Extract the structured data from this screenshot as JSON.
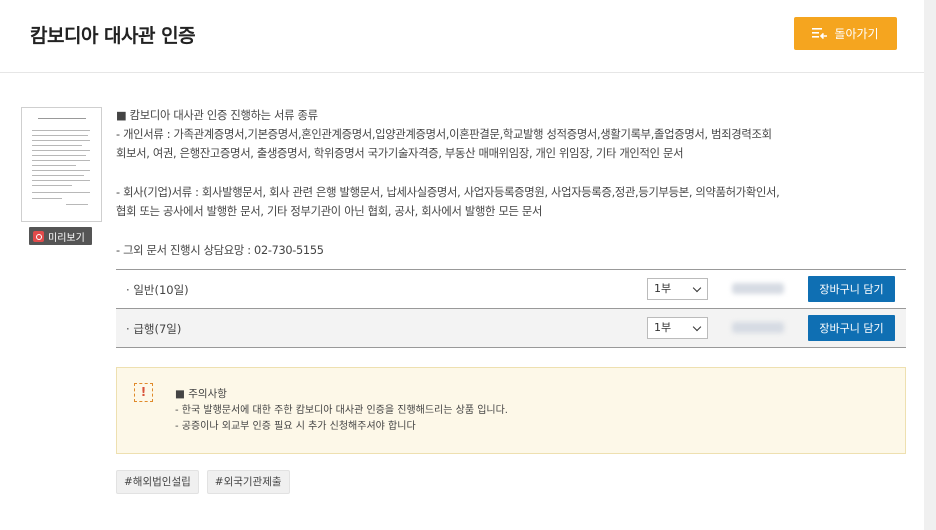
{
  "header": {
    "title": "캄보디아 대사관 인증",
    "back_label": "돌아가기"
  },
  "preview": {
    "label": "미리보기"
  },
  "description": {
    "heading": "■ 캄보디아 대사관 인증 진행하는 서류 종류",
    "personal_1": "- 개인서류 : 가족관계증명서,기본증명서,혼인관계증명서,입양관계증명서,이혼판결문,학교발행 성적증명서,생활기록부,졸업증명서, 범죄경력조회",
    "personal_2": "회보서, 여권, 은행잔고증명서, 출생증명서, 학위증명서 국가기술자격증, 부동산 매매위임장, 개인 위임장, 기타 개인적인 문서",
    "company_1": "- 회사(기업)서류 : 회사발행문서, 회사 관련 은행 발행문서, 납세사실증명서, 사업자등록증명원, 사업자등록증,정관,등기부등본, 의약품허가확인서,",
    "company_2": "협회 또는 공사에서 발행한 문서, 기타 정부기관이 아닌 협회, 공사, 회사에서 발행한 모든 문서",
    "contact": "- 그외 문서 진행시 상담요망 : 02-730-5155"
  },
  "options": [
    {
      "name": "일반(10일)",
      "qty": "1부",
      "cart_label": "장바구니 담기"
    },
    {
      "name": "급행(7일)",
      "qty": "1부",
      "cart_label": "장바구니 담기"
    }
  ],
  "notice": {
    "icon": "!",
    "title": "■ 주의사항",
    "line_1": "- 한국 발행문서에 대한 주한 캄보디아 대사관 인증을 진행해드리는 상품 입니다.",
    "line_2": "- 공증이나 외교부 인증 필요 시 추가 신청해주셔야 합니다"
  },
  "tags": [
    "#해외법인설립",
    "#외국기관제출"
  ],
  "colors": {
    "accent": "#f5a51f",
    "cart_button": "#0f6fb3",
    "notice_bg": "#fdf8e8"
  }
}
